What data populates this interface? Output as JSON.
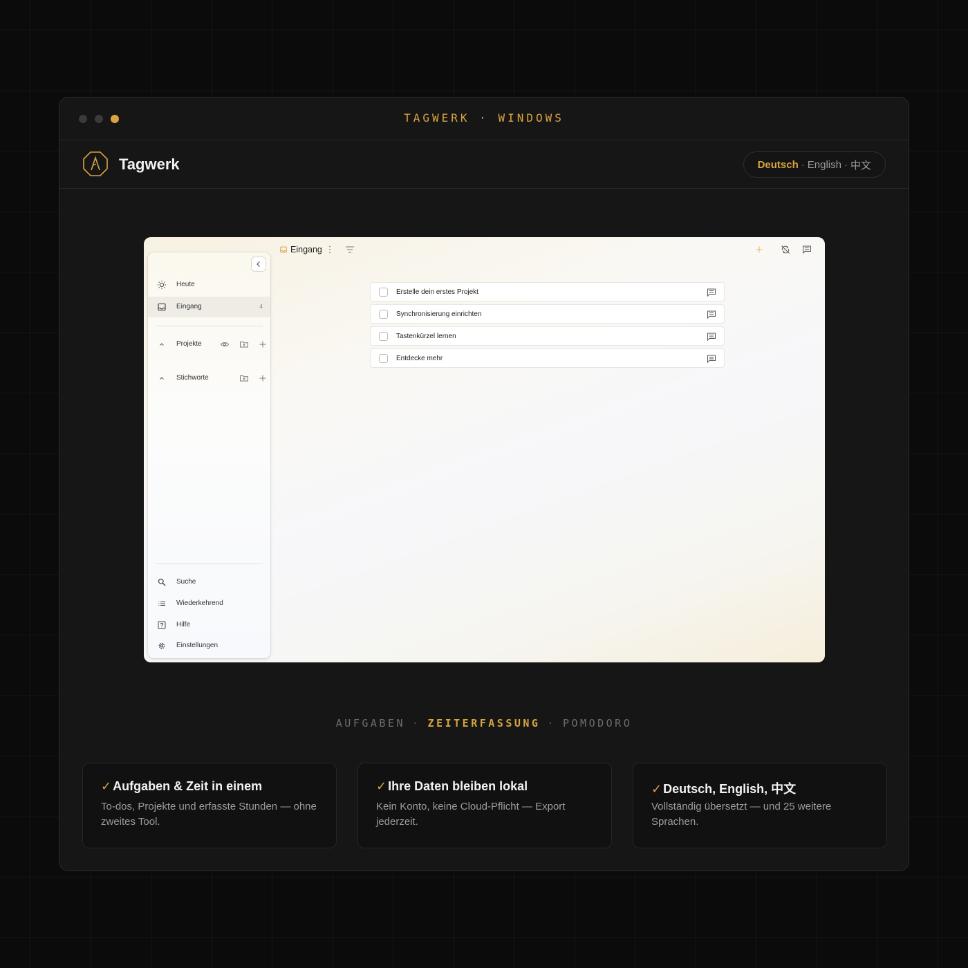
{
  "window": {
    "title": "TAGWERK · WINDOWS"
  },
  "header": {
    "brand": "Tagwerk",
    "languages": [
      "Deutsch",
      "English",
      "中文"
    ],
    "language_sep": "·",
    "active_language": "Deutsch"
  },
  "app": {
    "toolbar": {
      "title": "Eingang"
    },
    "sidebar": {
      "items": [
        {
          "label": "Heute",
          "icon": "sun-icon"
        },
        {
          "label": "Eingang",
          "icon": "inbox-icon",
          "count": "4",
          "active": true
        }
      ],
      "sections": [
        {
          "label": "Projekte"
        },
        {
          "label": "Stichworte"
        }
      ],
      "footer": [
        {
          "label": "Suche",
          "icon": "search-icon"
        },
        {
          "label": "Wiederkehrend",
          "icon": "list-icon"
        },
        {
          "label": "Hilfe",
          "icon": "help-icon"
        },
        {
          "label": "Einstellungen",
          "icon": "gear-icon"
        }
      ]
    },
    "tasks": [
      "Erstelle dein erstes Projekt",
      "Synchronisierung einrichten",
      "Tastenkürzel lernen",
      "Entdecke mehr"
    ]
  },
  "tabs": {
    "items": [
      "AUFGABEN",
      "ZEITERFASSUNG",
      "POMODORO"
    ],
    "active": "ZEITERFASSUNG",
    "sep": "·"
  },
  "features": [
    {
      "check": "✓",
      "title": "Aufgaben & Zeit in einem",
      "desc": "To-dos, Projekte und erfasste Stunden — ohne zweites Tool."
    },
    {
      "check": "✓",
      "title": "Ihre Daten bleiben lokal",
      "desc": "Kein Konto, keine Cloud-Pflicht — Export jederzeit."
    },
    {
      "check": "✓",
      "title": "Deutsch, English, 中文",
      "desc": "Vollständig übersetzt — und 25 weitere Sprachen."
    }
  ],
  "colors": {
    "accent": "#d9a441",
    "background": "#0b0b0b",
    "panel": "#161616"
  }
}
